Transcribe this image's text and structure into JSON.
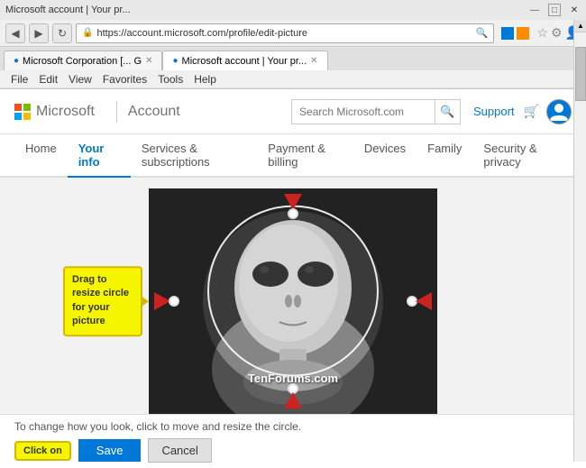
{
  "window": {
    "title": "Microsoft account | Your pr...",
    "tab1": "Microsoft Corporation [... G",
    "tab2": "Microsoft account | Your pr..."
  },
  "browser": {
    "back_title": "Back",
    "forward_title": "Forward",
    "refresh_title": "Refresh",
    "home_title": "Home",
    "url": "https://account.microsoft.com/profile/edit-picture",
    "search_placeholder": "Search Microsoft.com",
    "menu_items": [
      "File",
      "Edit",
      "View",
      "Favorites",
      "Tools",
      "Help"
    ]
  },
  "header": {
    "logo_text": "Microsoft",
    "account_label": "Account",
    "search_placeholder": "Search Microsoft.com",
    "support_label": "Support"
  },
  "nav": {
    "tabs": [
      {
        "label": "Home",
        "active": false
      },
      {
        "label": "Your info",
        "active": true
      },
      {
        "label": "Services & subscriptions",
        "active": false
      },
      {
        "label": "Payment & billing",
        "active": false
      },
      {
        "label": "Devices",
        "active": false
      },
      {
        "label": "Family",
        "active": false
      },
      {
        "label": "Security & privacy",
        "active": false
      }
    ]
  },
  "editor": {
    "tooltip_text": "Drag to resize circle for your picture",
    "watermark": "TenForums.com",
    "hint_text": "To change how you look, click to move and resize the circle.",
    "click_on_label": "Click on",
    "save_label": "Save",
    "cancel_label": "Cancel"
  }
}
